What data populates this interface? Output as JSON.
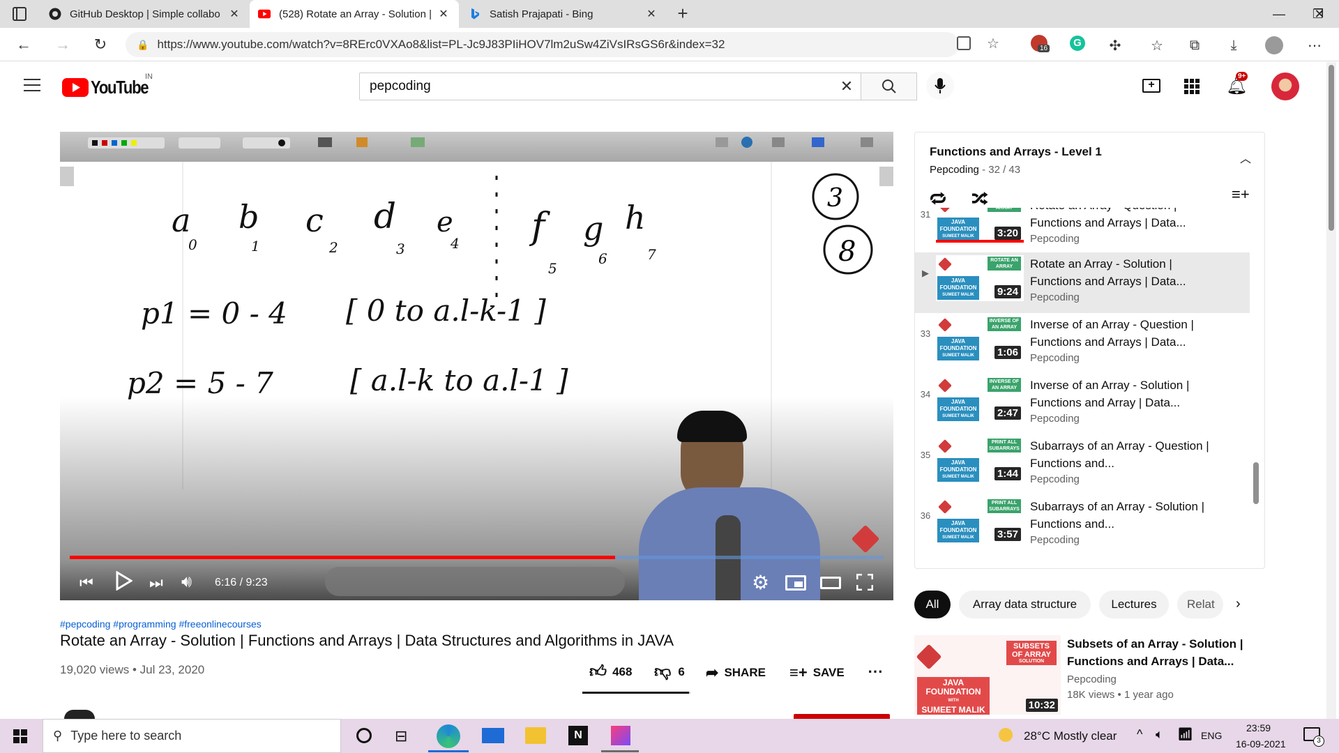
{
  "browser": {
    "tabs": [
      {
        "title": "GitHub Desktop | Simple collabo",
        "icon": "github-icon"
      },
      {
        "title": "(528) Rotate an Array - Solution |",
        "icon": "youtube-icon"
      },
      {
        "title": "Satish Prajapati - Bing",
        "icon": "bing-icon"
      }
    ],
    "url": "https://www.youtube.com/watch?v=8RErc0VXAo8&list=PL-Jc9J83PIiHOV7lm2uSw4ZiVsIRsGS6r&index=32",
    "extension_badge": "16"
  },
  "youtube": {
    "logo_text": "YouTube",
    "region": "IN",
    "search_value": "pepcoding",
    "notification_badge": "9+"
  },
  "whiteboard": {
    "tools": [
      "Stylus",
      "Color",
      "Line",
      "Eraser",
      "Background",
      "Undo",
      "Redo",
      "Pages",
      "Previous",
      "Next",
      "Erase"
    ],
    "tools_right": [
      "Board",
      "Web",
      "Documents",
      "Show Desktop",
      "OpenBoard"
    ],
    "letters": [
      "a",
      "b",
      "c",
      "d",
      "e",
      "f",
      "g",
      "h"
    ],
    "indices": [
      "0",
      "1",
      "2",
      "3",
      "4",
      "5",
      "6",
      "7"
    ],
    "circle_1": "3",
    "circle_2": "8",
    "line1_left": "p1 = 0 - 4",
    "line1_right": "[ 0  to  a.l-k-1 ]",
    "line2_left": "p2 = 5 - 7",
    "line2_right": "[ a.l-k  to  a.l-1 ]"
  },
  "player": {
    "time": "6:16 / 9:23",
    "progress": 0.67
  },
  "video": {
    "hashtags": "#pepcoding #programming #freeonlinecourses",
    "title": "Rotate an Array - Solution | Functions and Arrays | Data Structures and Algorithms in JAVA",
    "views_date": "19,020 views • Jul 23, 2020",
    "likes": "468",
    "dislikes": "6",
    "share": "SHARE",
    "save": "SAVE",
    "like_ratio": 0.987
  },
  "playlist": {
    "title": "Functions and Arrays - Level 1",
    "channel": "Pepcoding",
    "position": "32 / 43",
    "items": [
      {
        "num": "31",
        "title": "Rotate an Array - Question | Functions and Arrays | Data...",
        "channel": "Pepcoding",
        "duration": "3:20",
        "thumb": "ROTATE AN ARRAY",
        "watched": 1.0
      },
      {
        "num": "▶",
        "title": "Rotate an Array - Solution | Functions and Arrays | Data...",
        "channel": "Pepcoding",
        "duration": "9:24",
        "thumb": "ROTATE AN ARRAY",
        "current": true
      },
      {
        "num": "33",
        "title": "Inverse of an Array - Question | Functions and Arrays | Data...",
        "channel": "Pepcoding",
        "duration": "1:06",
        "thumb": "INVERSE OF AN ARRAY"
      },
      {
        "num": "34",
        "title": "Inverse of an Array - Solution | Functions and Array | Data...",
        "channel": "Pepcoding",
        "duration": "2:47",
        "thumb": "INVERSE OF AN ARRAY"
      },
      {
        "num": "35",
        "title": "Subarrays of an Array - Question | Functions and...",
        "channel": "Pepcoding",
        "duration": "1:44",
        "thumb": "PRINT ALL SUBARRAYS"
      },
      {
        "num": "36",
        "title": "Subarrays of an Array - Solution | Functions and...",
        "channel": "Pepcoding",
        "duration": "3:57",
        "thumb": "PRINT ALL SUBARRAYS"
      }
    ],
    "thumb_label": "JAVA FOUNDATION",
    "thumb_sub": "SUMEET MALIK"
  },
  "chips": [
    "All",
    "Array data structure",
    "Lectures",
    "Relat"
  ],
  "recommended": {
    "title": "Subsets of an Array - Solution | Functions and Arrays | Data...",
    "channel": "Pepcoding",
    "meta": "18K views • 1 year ago",
    "duration": "10:32",
    "thumb_title": "SUBSETS OF ARRAY",
    "thumb_sub": "SOLUTION",
    "thumb_label": "JAVA FOUNDATION",
    "thumb_with": "WITH",
    "thumb_name": "SUMEET MALIK"
  },
  "taskbar": {
    "search_placeholder": "Type here to search",
    "weather": "28°C  Mostly clear",
    "lang": "ENG",
    "time": "23:59",
    "date": "16-09-2021",
    "notif_count": "3"
  },
  "colors": {
    "youtube_red": "#ff0000",
    "link_blue": "#065fd4",
    "taskbar": "#e7d7e8"
  }
}
